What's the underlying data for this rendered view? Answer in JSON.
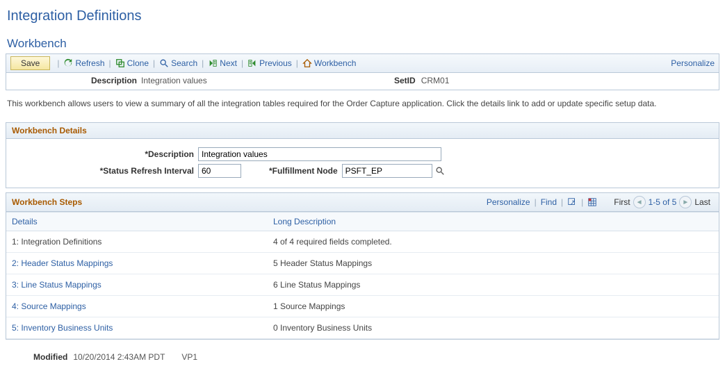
{
  "page_title": "Integration Definitions",
  "section_title": "Workbench",
  "toolbar": {
    "save": "Save",
    "refresh": "Refresh",
    "clone": "Clone",
    "search": "Search",
    "next": "Next",
    "previous": "Previous",
    "workbench": "Workbench",
    "personalize": "Personalize"
  },
  "info": {
    "description_label": "Description",
    "description_value": "Integration values",
    "setid_label": "SetID",
    "setid_value": "CRM01"
  },
  "instructions": "This workbench allows users to view a summary of all the integration tables required for the Order Capture application. Click the details link to add or update specific setup data.",
  "details_group": {
    "title": "Workbench Details",
    "description_label": "*Description",
    "description_value": "Integration values",
    "interval_label": "*Status Refresh Interval",
    "interval_value": "60",
    "node_label": "*Fulfillment Node",
    "node_value": "PSFT_EP"
  },
  "steps_group": {
    "title": "Workbench Steps",
    "personalize": "Personalize",
    "find": "Find",
    "first": "First",
    "range": "1-5 of 5",
    "last": "Last",
    "columns": {
      "details": "Details",
      "long_desc": "Long Description"
    },
    "rows": [
      {
        "num": "1:",
        "label": "Integration Definitions",
        "link": false,
        "desc": "4 of 4 required fields completed."
      },
      {
        "num": "2:",
        "label": "Header Status Mappings",
        "link": true,
        "desc": "5 Header Status Mappings"
      },
      {
        "num": "3:",
        "label": "Line Status Mappings",
        "link": true,
        "desc": "6 Line Status Mappings"
      },
      {
        "num": "4:",
        "label": "Source Mappings",
        "link": true,
        "desc": "1 Source Mappings"
      },
      {
        "num": "5:",
        "label": "Inventory Business Units",
        "link": true,
        "desc": "0 Inventory Business Units"
      }
    ]
  },
  "footer": {
    "modified_label": "Modified",
    "modified_value": "10/20/2014  2:43AM PDT",
    "user": "VP1"
  }
}
